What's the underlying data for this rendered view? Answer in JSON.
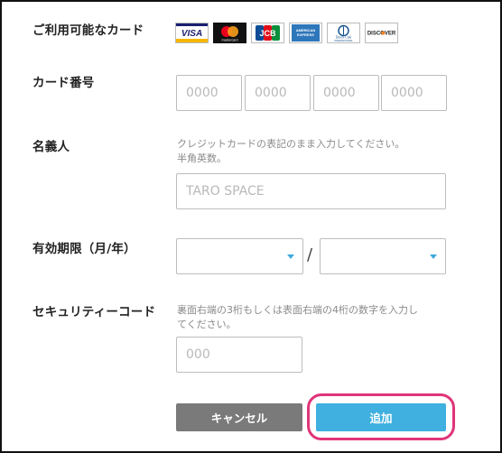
{
  "labels": {
    "cards": "ご利用可能なカード",
    "card_number": "カード番号",
    "holder": "名義人",
    "expiry": "有効期限（月/年）",
    "security_code": "セキュリティーコード"
  },
  "card_logos": [
    {
      "name": "visa",
      "text": "VISA"
    },
    {
      "name": "mastercard",
      "text": "mastercard"
    },
    {
      "name": "jcb",
      "text": "JCB"
    },
    {
      "name": "amex",
      "text": "AMERICAN EXPRESS"
    },
    {
      "name": "diners",
      "text": "Diners Club INTERNATIONAL"
    },
    {
      "name": "discover",
      "text": "DISCOVER"
    }
  ],
  "card_number": {
    "placeholders": [
      "0000",
      "0000",
      "0000",
      "0000"
    ]
  },
  "holder": {
    "hint_line1": "クレジットカードの表記のまま入力してください。",
    "hint_line2": "半角英数。",
    "placeholder": "TARO SPACE"
  },
  "expiry": {
    "separator": "/",
    "month_value": "",
    "year_value": ""
  },
  "security_code": {
    "hint_line1": "裏面右端の3桁もしくは表面右端の4桁の数字を入力し",
    "hint_line2": "てください。",
    "placeholder": "000"
  },
  "buttons": {
    "cancel": "キャンセル",
    "add": "追加"
  },
  "colors": {
    "add_button": "#3fb0df",
    "cancel_button": "#7a7a7a",
    "highlight": "#e0357a",
    "caret": "#3ea9dc"
  }
}
